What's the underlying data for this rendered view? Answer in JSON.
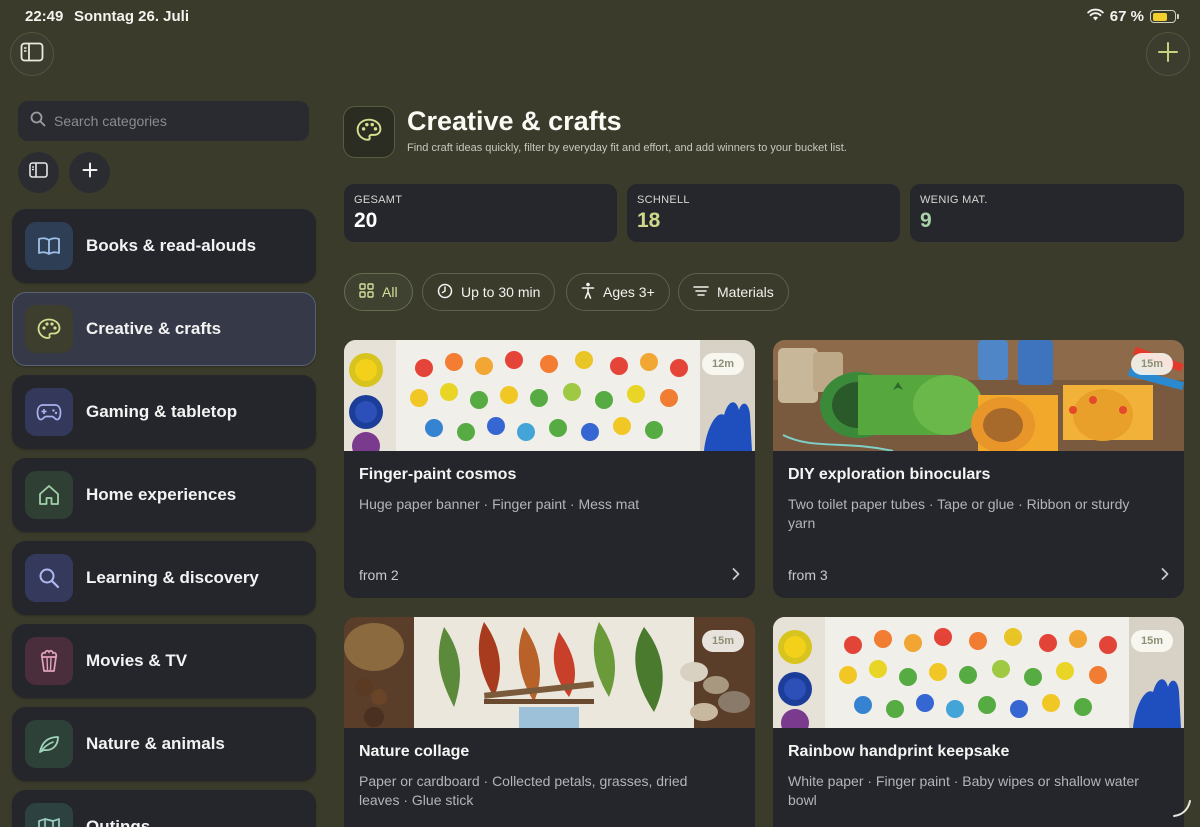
{
  "status_bar": {
    "time": "22:49",
    "date": "Sonntag 26. Juli",
    "battery_text": "67 %",
    "battery_level": 0.67,
    "icons": [
      "wifi-icon",
      "battery-icon"
    ]
  },
  "sidebar": {
    "search": {
      "placeholder": "Search categories",
      "value": ""
    },
    "items": [
      {
        "label": "Books & read-alouds",
        "icon": "book-icon",
        "icon_bg": "#2e3e55",
        "icon_color": "#9fc1ea",
        "active": false
      },
      {
        "label": "Creative & crafts",
        "icon": "palette-icon",
        "icon_bg": "#3d3e2e",
        "icon_color": "#d6dd8f",
        "active": true
      },
      {
        "label": "Gaming & tabletop",
        "icon": "gamepad-icon",
        "icon_bg": "#34385a",
        "icon_color": "#a9b2ef",
        "active": false
      },
      {
        "label": "Home experiences",
        "icon": "house-icon",
        "icon_bg": "#2f3f33",
        "icon_color": "#9fd2a8",
        "active": false
      },
      {
        "label": "Learning & discovery",
        "icon": "magnifier-icon",
        "icon_bg": "#353a5c",
        "icon_color": "#b1b8f0",
        "active": false
      },
      {
        "label": "Movies & TV",
        "icon": "popcorn-icon",
        "icon_bg": "#4a2e3b",
        "icon_color": "#e0a3bd",
        "active": false
      },
      {
        "label": "Nature & animals",
        "icon": "leaf-icon",
        "icon_bg": "#2e4138",
        "icon_color": "#9fd4b9",
        "active": false
      },
      {
        "label": "Outings",
        "icon": "map-icon",
        "icon_bg": "#2d4240",
        "icon_color": "#9dd2c8",
        "active": false
      }
    ]
  },
  "header": {
    "icon": "palette-icon",
    "title": "Creative & crafts",
    "subtitle": "Find craft ideas quickly, filter by everyday fit and effort, and add winners to your bucket list."
  },
  "stats": [
    {
      "label": "GESAMT",
      "value": "20",
      "color": "#ffffff"
    },
    {
      "label": "SCHNELL",
      "value": "18",
      "color": "#cfd98a"
    },
    {
      "label": "WENIG MAT.",
      "value": "9",
      "color": "#a8d4a8"
    }
  ],
  "filters": [
    {
      "label": "All",
      "icon": "grid-icon",
      "active": true
    },
    {
      "label": "Up to 30 min",
      "icon": "clock-icon",
      "active": false
    },
    {
      "label": "Ages 3+",
      "icon": "person-icon",
      "active": false
    },
    {
      "label": "Materials",
      "icon": "filter-lines-icon",
      "active": false
    }
  ],
  "cards": [
    {
      "title": "Finger-paint cosmos",
      "duration": "12m",
      "materials": "Huge paper banner · Finger paint · Mess mat",
      "from": "from 2",
      "image": "handprint-rainbow"
    },
    {
      "title": "DIY exploration binoculars",
      "duration": "15m",
      "materials": "Two toilet paper tubes · Tape or glue · Ribbon or sturdy yarn",
      "from": "from 3",
      "image": "binoculars"
    },
    {
      "title": "Nature collage",
      "duration": "15m",
      "materials": "Paper or cardboard · Collected petals, grasses, dried leaves · Glue stick",
      "from": "",
      "image": "nature-collage"
    },
    {
      "title": "Rainbow handprint keepsake",
      "duration": "15m",
      "materials": "White paper · Finger paint · Baby wipes or shallow water bowl",
      "from": "",
      "image": "handprint-rainbow"
    }
  ],
  "colors": {
    "background": "#3a3b2b",
    "card": "#24262c",
    "accent": "#d3e09a"
  }
}
